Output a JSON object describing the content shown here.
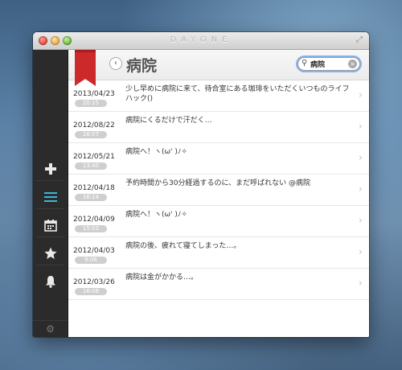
{
  "window": {
    "title": "DAYONE"
  },
  "sidebar": {
    "items": [
      {
        "name": "add",
        "icon": "plus-icon"
      },
      {
        "name": "list",
        "icon": "list-icon",
        "active": true,
        "accent": "#39b7d8"
      },
      {
        "name": "calendar",
        "icon": "calendar-icon"
      },
      {
        "name": "starred",
        "icon": "star-icon"
      },
      {
        "name": "reminders",
        "icon": "bell-icon"
      }
    ],
    "settings_icon": "gear-icon"
  },
  "header": {
    "title": "病院",
    "back_icon": "chevron-left-icon",
    "bookmark_color": "#cc2a2a"
  },
  "search": {
    "value": "病院",
    "icon": "search-icon",
    "clear_icon": "clear-icon"
  },
  "entries": [
    {
      "date": "2013/04/23",
      "time": "20:15",
      "text": "少し早めに病院に来て、待合室にある珈琲をいただくいつものライフハック()"
    },
    {
      "date": "2012/08/22",
      "time": "16:07",
      "text": "病院にくるだけで汗だく…"
    },
    {
      "date": "2012/05/21",
      "time": "13:40",
      "text": "病院へ！ヽ(ω' )ﾉ✧"
    },
    {
      "date": "2012/04/18",
      "time": "16:14",
      "text": "予約時間から30分経過するのに、まだ呼ばれない @病院"
    },
    {
      "date": "2012/04/09",
      "time": "15:02",
      "text": "病院へ！ヽ(ω' )ﾉ✧"
    },
    {
      "date": "2012/04/03",
      "time": "9:06",
      "text": "病院の後、疲れて寝てしまった…。"
    },
    {
      "date": "2012/03/26",
      "time": "16:06",
      "text": "病院は金がかかる…。"
    }
  ]
}
